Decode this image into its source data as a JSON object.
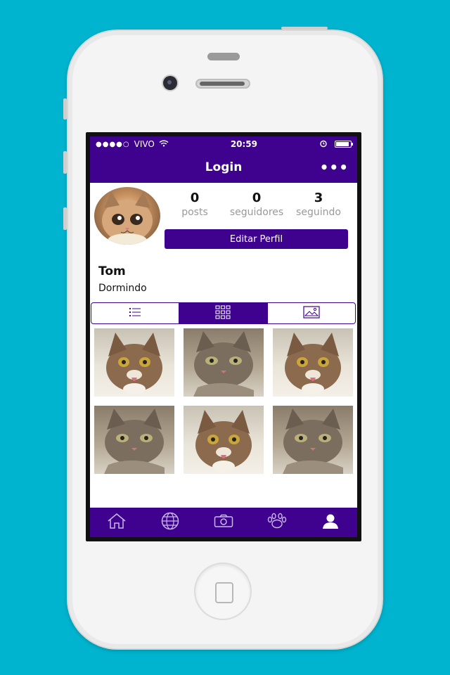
{
  "status_bar": {
    "carrier": "VIVO",
    "time": "20:59"
  },
  "nav": {
    "title": "Login",
    "more_icon": "ellipsis-icon"
  },
  "profile": {
    "stats": [
      {
        "value": "0",
        "label": "posts"
      },
      {
        "value": "0",
        "label": "seguidores"
      },
      {
        "value": "3",
        "label": "seguindo"
      }
    ],
    "edit_button": "Editar Perfil",
    "name": "Tom",
    "bio": "Dormindo"
  },
  "view_toggle": {
    "options": [
      "list-icon",
      "grid-icon",
      "image-icon"
    ],
    "selected": "grid-icon"
  },
  "photos": [
    "cat-a",
    "cat-b",
    "cat-a",
    "cat-b",
    "cat-a",
    "cat-b"
  ],
  "tab_bar": {
    "items": [
      "home-icon",
      "globe-icon",
      "camera-icon",
      "paw-icon",
      "profile-icon"
    ],
    "selected": "profile-icon"
  },
  "colors": {
    "primary": "#3f028f",
    "background": "#00b4cf"
  }
}
